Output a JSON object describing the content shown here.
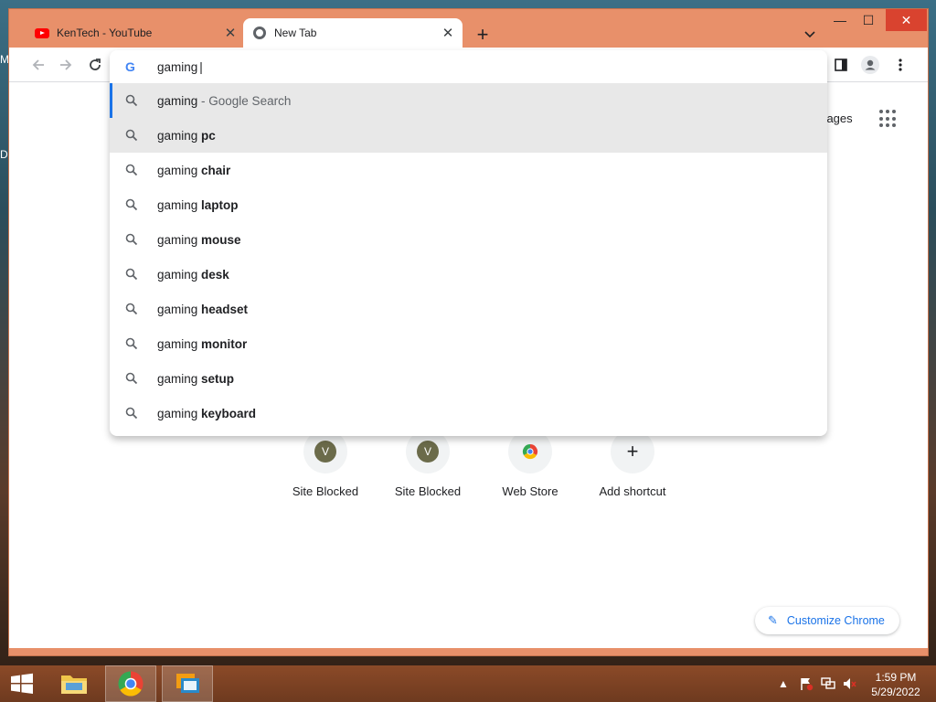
{
  "desktop": {
    "frag_top": "M",
    "frag_mid": "D"
  },
  "tabs": [
    {
      "title": "KenTech - YouTube",
      "close": "✕"
    },
    {
      "title": "New Tab",
      "close": "✕"
    }
  ],
  "window_controls": {
    "minimize": "—",
    "maximize": "☐",
    "close": "✕"
  },
  "new_tab_symbol": "+",
  "omnibox": {
    "query": "gaming",
    "google_mark": "G",
    "suggestions": [
      {
        "query": "gaming",
        "bold": "",
        "meta": " - Google Search"
      },
      {
        "query": "gaming ",
        "bold": "pc",
        "meta": ""
      },
      {
        "query": "gaming ",
        "bold": "chair",
        "meta": ""
      },
      {
        "query": "gaming ",
        "bold": "laptop",
        "meta": ""
      },
      {
        "query": "gaming ",
        "bold": "mouse",
        "meta": ""
      },
      {
        "query": "gaming ",
        "bold": "desk",
        "meta": ""
      },
      {
        "query": "gaming ",
        "bold": "headset",
        "meta": ""
      },
      {
        "query": "gaming ",
        "bold": "monitor",
        "meta": ""
      },
      {
        "query": "gaming ",
        "bold": "setup",
        "meta": ""
      },
      {
        "query": "gaming ",
        "bold": "keyboard",
        "meta": ""
      }
    ]
  },
  "newtab": {
    "images_link": "Images",
    "shortcuts": [
      {
        "label": "Site Blocked",
        "letter": "V"
      },
      {
        "label": "Site Blocked",
        "letter": "V"
      },
      {
        "label": "Web Store",
        "letter": ""
      },
      {
        "label": "Add shortcut",
        "letter": "+"
      }
    ],
    "customize_label": "Customize Chrome"
  },
  "taskbar": {
    "clock_time": "1:59 PM",
    "clock_date": "5/29/2022"
  },
  "colors": {
    "accent": "#1a73e8",
    "window_frame": "#e8906a",
    "close_btn": "#d9432f"
  }
}
